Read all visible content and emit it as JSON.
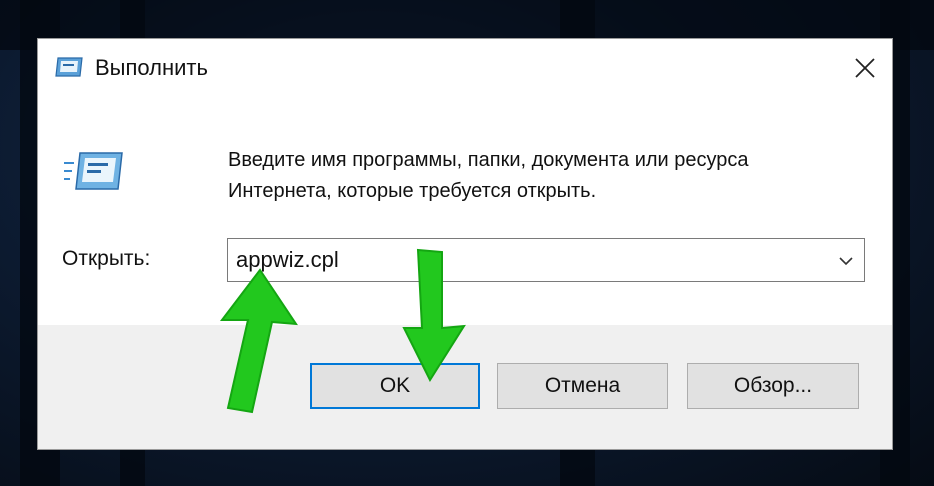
{
  "window": {
    "title": "Выполнить",
    "close_icon": "close-icon",
    "app_icon": "run-icon"
  },
  "content": {
    "description_line1": "Введите имя программы, папки, документа или ресурса",
    "description_line2": "Интернета, которые требуется открыть.",
    "open_label": "Открыть:",
    "command_value": "appwiz.cpl"
  },
  "buttons": {
    "ok": "OK",
    "cancel": "Отмена",
    "browse": "Обзор..."
  },
  "annotations": {
    "arrow_color": "#22c81e"
  },
  "colors": {
    "accent": "#0078d7",
    "dialog_bg": "#f0f0f0"
  }
}
